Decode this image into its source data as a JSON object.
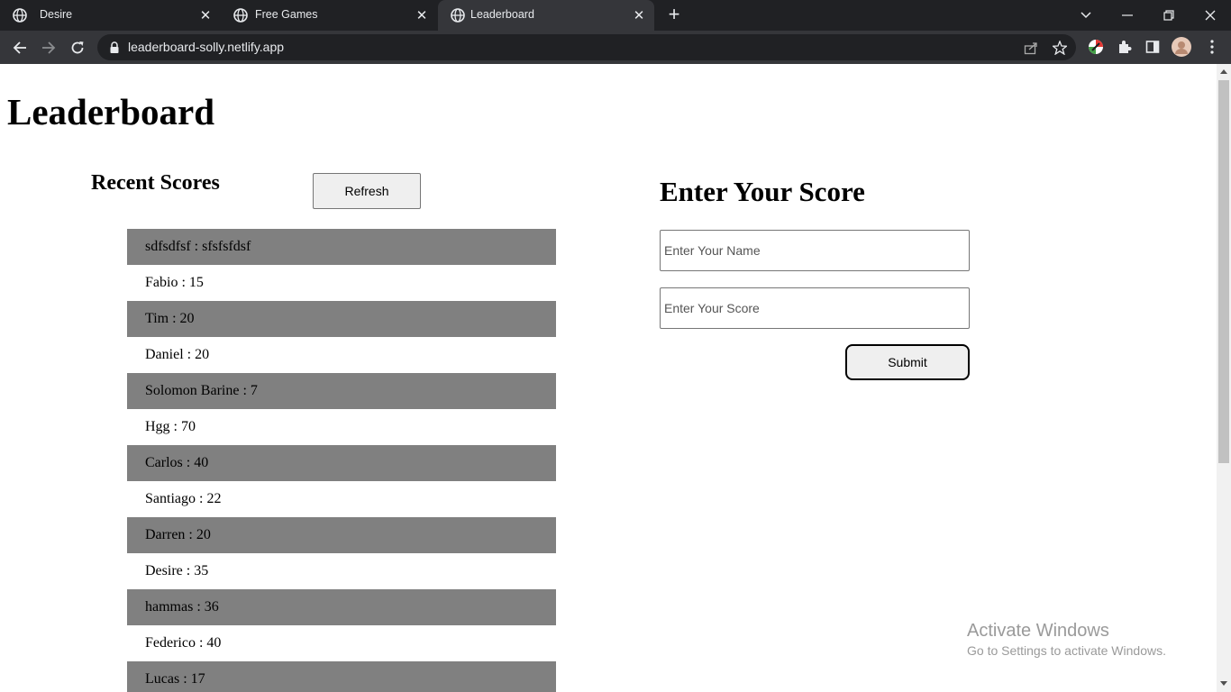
{
  "browser": {
    "tabs": [
      {
        "title": "Desire",
        "active": false
      },
      {
        "title": "Free Games",
        "active": false
      },
      {
        "title": "Leaderboard",
        "active": true
      }
    ],
    "url": "leaderboard-solly.netlify.app"
  },
  "page": {
    "title": "Leaderboard",
    "recent": {
      "heading": "Recent Scores",
      "refresh_label": "Refresh",
      "scores": [
        "sdfsdfsf : sfsfsfdsf",
        "Fabio : 15",
        "Tim : 20",
        "Daniel : 20",
        "Solomon Barine : 7",
        "Hgg : 70",
        "Carlos : 40",
        "Santiago : 22",
        "Darren : 20",
        "Desire : 35",
        "hammas : 36",
        "Federico : 40",
        "Lucas : 17"
      ]
    },
    "form": {
      "heading": "Enter Your Score",
      "name_placeholder": "Enter Your Name",
      "score_placeholder": "Enter Your Score",
      "submit_label": "Submit"
    }
  },
  "watermark": {
    "line1": "Activate Windows",
    "line2": "Go to Settings to activate Windows."
  },
  "colors": {
    "chrome_dark": "#202124",
    "chrome_toolbar": "#35363a",
    "row_stripe": "#808080"
  }
}
